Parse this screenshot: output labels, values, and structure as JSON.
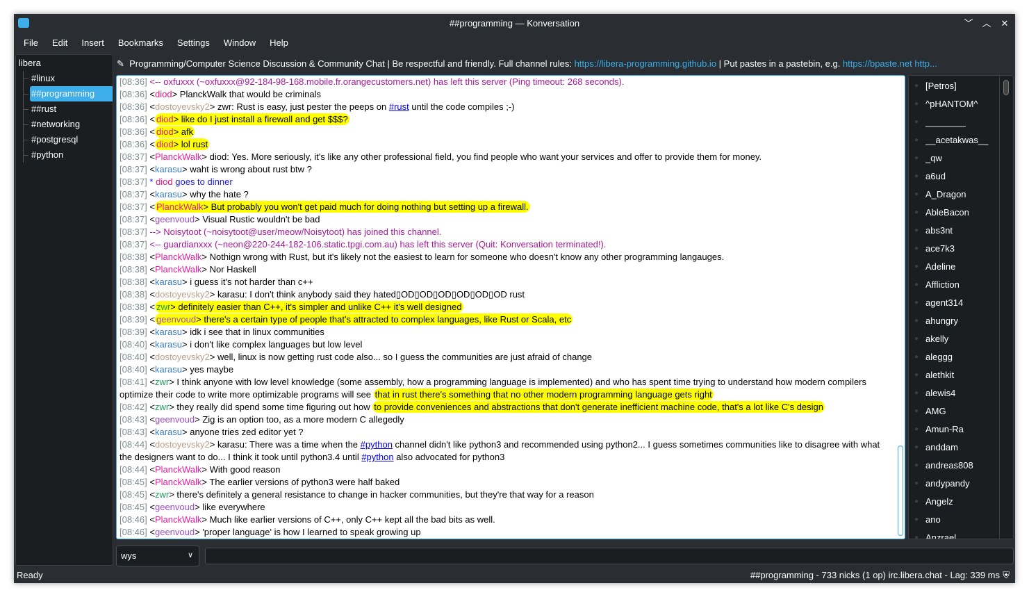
{
  "window": {
    "title": "##programming — Konversation",
    "controls": [
      "﹀",
      "︿",
      "✕"
    ]
  },
  "menu": [
    "File",
    "Edit",
    "Insert",
    "Bookmarks",
    "Settings",
    "Window",
    "Help"
  ],
  "tree": {
    "server": "libera",
    "channels": [
      "#linux",
      "##programming",
      "##rust",
      "#networking",
      "#postgresql",
      "#python"
    ],
    "selected": 1
  },
  "topic": {
    "text1": "Programming/Computer Science Discussion & Community Chat | Be respectful and friendly. Full channel rules: ",
    "link1": "https://libera-programming.github.io",
    "text2": " | Put pastes in a pastebin, e.g. ",
    "link2": "https://bpaste.net",
    "link3": "http..."
  },
  "nick_colors": {
    "diod": "#e3147e",
    "dostoyevsky2": "#bba089",
    "PlanckWalk": "#e61ea0",
    "karasu": "#3b7fc4",
    "geenvoud": "#9b4fc4",
    "zwr": "#1b9d5a"
  },
  "colors": {
    "server": "#a5199a",
    "action": "#1a1aee",
    "accent": "#3daee9",
    "highlight": "#ffff00"
  },
  "messages": [
    {
      "time": "[08:36]",
      "type": "server",
      "parts": [
        {
          "t": "<-- oxfuxxx (~oxfuxxx@92-184-98-168.mobile.fr.orangecustomers.net) has left this server (Ping timeout: 268 seconds)."
        }
      ]
    },
    {
      "time": "[08:36]",
      "nick": "diod",
      "parts": [
        {
          "t": " PlanckWalk that would be criminals"
        }
      ]
    },
    {
      "time": "[08:36]",
      "nick": "dostoyevsky2",
      "parts": [
        {
          "t": " zwr: Rust is easy, just pester the peeps on "
        },
        {
          "t": "#rust",
          "link": true
        },
        {
          "t": " until the code compiles ;-)"
        }
      ]
    },
    {
      "time": "[08:36]",
      "nick": "diod",
      "hl": true,
      "parts": [
        {
          "t": " like do I just install a firewall and get $$$?",
          "hl": true
        }
      ]
    },
    {
      "time": "[08:36]",
      "nick": "diod",
      "hl": true,
      "parts": [
        {
          "t": " afk",
          "hl": true
        }
      ]
    },
    {
      "time": "[08:36]",
      "nick": "diod",
      "hl": true,
      "parts": [
        {
          "t": " lol rust",
          "hl": true
        }
      ]
    },
    {
      "time": "[08:37]",
      "nick": "PlanckWalk",
      "parts": [
        {
          "t": " diod: Yes.  More seriously, it's like any other professional field, you find people who want your services and offer to provide them for money."
        }
      ]
    },
    {
      "time": "[08:37]",
      "nick": "karasu",
      "parts": [
        {
          "t": " waht is wrong about rust btw ?"
        }
      ]
    },
    {
      "time": "[08:37]",
      "type": "action",
      "nick": "diod",
      "parts": [
        {
          "t": " goes to dinner"
        }
      ]
    },
    {
      "time": "[08:37]",
      "nick": "karasu",
      "parts": [
        {
          "t": " why the hate ?"
        }
      ]
    },
    {
      "time": "[08:37]",
      "nick": "PlanckWalk",
      "hl": true,
      "parts": [
        {
          "t": " But probably you won't get paid much for doing nothing but setting up a firewall.",
          "hl": true
        }
      ]
    },
    {
      "time": "[08:37]",
      "nick": "geenvoud",
      "parts": [
        {
          "t": " Visual Rustic wouldn't be bad"
        }
      ]
    },
    {
      "time": "[08:37]",
      "type": "server",
      "parts": [
        {
          "t": "--> Noisytoot (~noisytoot@user/meow/Noisytoot) has joined this channel."
        }
      ]
    },
    {
      "time": "[08:37]",
      "type": "server",
      "parts": [
        {
          "t": "<-- guardianxxx (~neon@220-244-182-106.static.tpgi.com.au) has left this server (Quit: Konversation terminated!)."
        }
      ]
    },
    {
      "time": "[08:38]",
      "nick": "PlanckWalk",
      "parts": [
        {
          "t": " Nothign wrong with Rust, but it's likely not the easiest to learn for someone who doesn't know any other programming langauges."
        }
      ]
    },
    {
      "time": "[08:38]",
      "nick": "PlanckWalk",
      "parts": [
        {
          "t": " Nor Haskell"
        }
      ]
    },
    {
      "time": "[08:38]",
      "nick": "karasu",
      "parts": [
        {
          "t": " i guess it's not harder than c++"
        }
      ]
    },
    {
      "time": "[08:38]",
      "nick": "dostoyevsky2",
      "parts": [
        {
          "t": " karasu: I don't think anybody said they hated▯OD▯OD▯OD▯OD▯OD▯OD rust"
        }
      ]
    },
    {
      "time": "[08:38]",
      "nick": "zwr",
      "hl": true,
      "parts": [
        {
          "t": " definitely easier than C++, it's simpler and unlike C++ it's well designed",
          "hl": true
        }
      ]
    },
    {
      "time": "[08:39]",
      "nick": "geenvoud",
      "hl": true,
      "parts": [
        {
          "t": " there's a certain type of people that's attracted to complex languages, like Rust or Scala, etc",
          "hl": true
        }
      ]
    },
    {
      "time": "[08:39]",
      "nick": "karasu",
      "parts": [
        {
          "t": " idk i see that in linux communities"
        }
      ]
    },
    {
      "time": "[08:40]",
      "nick": "karasu",
      "parts": [
        {
          "t": " i don't like complex languages but low level"
        }
      ]
    },
    {
      "time": "[08:40]",
      "nick": "dostoyevsky2",
      "parts": [
        {
          "t": " well, linux is now getting rust code also... so I guess the communities are just afraid of change"
        }
      ]
    },
    {
      "time": "[08:40]",
      "nick": "karasu",
      "parts": [
        {
          "t": " yes maybe"
        }
      ]
    },
    {
      "time": "[08:41]",
      "nick": "zwr",
      "parts": [
        {
          "t": " I think anyone with low level knowledge (some assembly, how a programming language is implemented) and who has spent time trying to understand how modern compilers optimize their code to write more optimizable programs will see "
        },
        {
          "t": "that in rust there's something that no other modern programming language gets right",
          "hl": true
        }
      ]
    },
    {
      "time": "[08:42]",
      "nick": "zwr",
      "parts": [
        {
          "t": " they really did spend some time figuring out how "
        },
        {
          "t": "to provide conveniences and abstractions that don't generate inefficient machine code, that's a lot like C's design",
          "hl": true
        }
      ]
    },
    {
      "time": "[08:43]",
      "nick": "geenvoud",
      "parts": [
        {
          "t": " Zig is an option too, as a more modern C allegedly"
        }
      ]
    },
    {
      "time": "[08:43]",
      "nick": "karasu",
      "parts": [
        {
          "t": " anyone tries zed editor yet ?"
        }
      ]
    },
    {
      "time": "[08:44]",
      "nick": "dostoyevsky2",
      "parts": [
        {
          "t": " karasu: There was a time when the "
        },
        {
          "t": "#python",
          "link": true
        },
        {
          "t": " channel didn't like python3 and recommended using python2... I guess sometimes communities like to disagree with what the designers want to do... I think it took until python3.4 until "
        },
        {
          "t": "#python",
          "link": true
        },
        {
          "t": " also advocated for python3"
        }
      ]
    },
    {
      "time": "[08:44]",
      "nick": "PlanckWalk",
      "parts": [
        {
          "t": " With good reason"
        }
      ]
    },
    {
      "time": "[08:45]",
      "nick": "PlanckWalk",
      "parts": [
        {
          "t": " The earlier versions of python3 were half baked"
        }
      ]
    },
    {
      "time": "[08:45]",
      "nick": "zwr",
      "parts": [
        {
          "t": " there's definitely a general resistance to change in hacker communities, but they're that way for a reason"
        }
      ]
    },
    {
      "time": "[08:45]",
      "nick": "geenvoud",
      "parts": [
        {
          "t": " like everywhere"
        }
      ]
    },
    {
      "time": "[08:46]",
      "nick": "PlanckWalk",
      "parts": [
        {
          "t": " Much like earlier versions of C++, only C++ kept all the bad bits as well."
        }
      ]
    },
    {
      "time": "[08:46]",
      "nick": "geenvoud",
      "parts": [
        {
          "t": " 'proper language' is how I learned to speak growing up"
        }
      ]
    }
  ],
  "nicklist": [
    "[Petros]",
    "^pHANTOM^",
    "________",
    "__acetakwas__",
    "_qw",
    "a6ud",
    "A_Dragon",
    "AbleBacon",
    "abs3nt",
    "ace7k3",
    "Adeline",
    "Affliction",
    "agent314",
    "ahungry",
    "akelly",
    "aleggg",
    "alethkit",
    "alewis4",
    "AMG",
    "Amun-Ra",
    "anddam",
    "andreas808",
    "andypandy",
    "Angelz",
    "ano",
    "Anzrael"
  ],
  "input": {
    "nick": "wys",
    "value": ""
  },
  "status": {
    "left": "Ready",
    "right": "##programming - 733 nicks (1 op) irc.libera.chat - Lag: 339 ms"
  }
}
